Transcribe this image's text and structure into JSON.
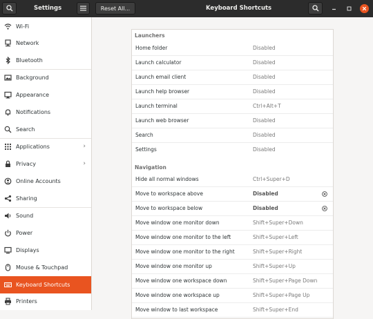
{
  "titlebar": {
    "settings_title": "Settings",
    "reset_label": "Reset All...",
    "window_title": "Keyboard Shortcuts",
    "close_color": "#e95420"
  },
  "sidebar": {
    "items": [
      {
        "label": "Wi-Fi",
        "icon": "wifi-icon"
      },
      {
        "label": "Network",
        "icon": "network-icon"
      },
      {
        "label": "Bluetooth",
        "icon": "bluetooth-icon"
      },
      {
        "label": "Background",
        "icon": "background-icon"
      },
      {
        "label": "Appearance",
        "icon": "appearance-icon"
      },
      {
        "label": "Notifications",
        "icon": "notifications-icon"
      },
      {
        "label": "Search",
        "icon": "search-icon"
      },
      {
        "label": "Applications",
        "icon": "applications-icon"
      },
      {
        "label": "Privacy",
        "icon": "privacy-icon"
      },
      {
        "label": "Online Accounts",
        "icon": "online-accounts-icon"
      },
      {
        "label": "Sharing",
        "icon": "sharing-icon"
      },
      {
        "label": "Sound",
        "icon": "sound-icon"
      },
      {
        "label": "Power",
        "icon": "power-icon"
      },
      {
        "label": "Displays",
        "icon": "displays-icon"
      },
      {
        "label": "Mouse & Touchpad",
        "icon": "mouse-icon"
      },
      {
        "label": "Keyboard Shortcuts",
        "icon": "keyboard-icon"
      },
      {
        "label": "Printers",
        "icon": "printer-icon"
      }
    ],
    "active_color": "#e95420"
  },
  "launchers": {
    "title": "Launchers",
    "rows": [
      {
        "name": "Home folder",
        "accel": "Disabled"
      },
      {
        "name": "Launch calculator",
        "accel": "Disabled"
      },
      {
        "name": "Launch email client",
        "accel": "Disabled"
      },
      {
        "name": "Launch help browser",
        "accel": "Disabled"
      },
      {
        "name": "Launch terminal",
        "accel": "Ctrl+Alt+T"
      },
      {
        "name": "Launch web browser",
        "accel": "Disabled"
      },
      {
        "name": "Search",
        "accel": "Disabled"
      },
      {
        "name": "Settings",
        "accel": "Disabled"
      }
    ]
  },
  "navigation": {
    "title": "Navigation",
    "rows": [
      {
        "name": "Hide all normal windows",
        "accel": "Ctrl+Super+D"
      },
      {
        "name": "Move to workspace above",
        "accel": "Disabled"
      },
      {
        "name": "Move to workspace below",
        "accel": "Disabled"
      },
      {
        "name": "Move window one monitor down",
        "accel": "Shift+Super+Down"
      },
      {
        "name": "Move window one monitor to the left",
        "accel": "Shift+Super+Left"
      },
      {
        "name": "Move window one monitor to the right",
        "accel": "Shift+Super+Right"
      },
      {
        "name": "Move window one monitor up",
        "accel": "Shift+Super+Up"
      },
      {
        "name": "Move window one workspace down",
        "accel": "Shift+Super+Page Down"
      },
      {
        "name": "Move window one workspace up",
        "accel": "Shift+Super+Page Up"
      },
      {
        "name": "Move window to last workspace",
        "accel": "Shift+Super+End"
      }
    ]
  }
}
